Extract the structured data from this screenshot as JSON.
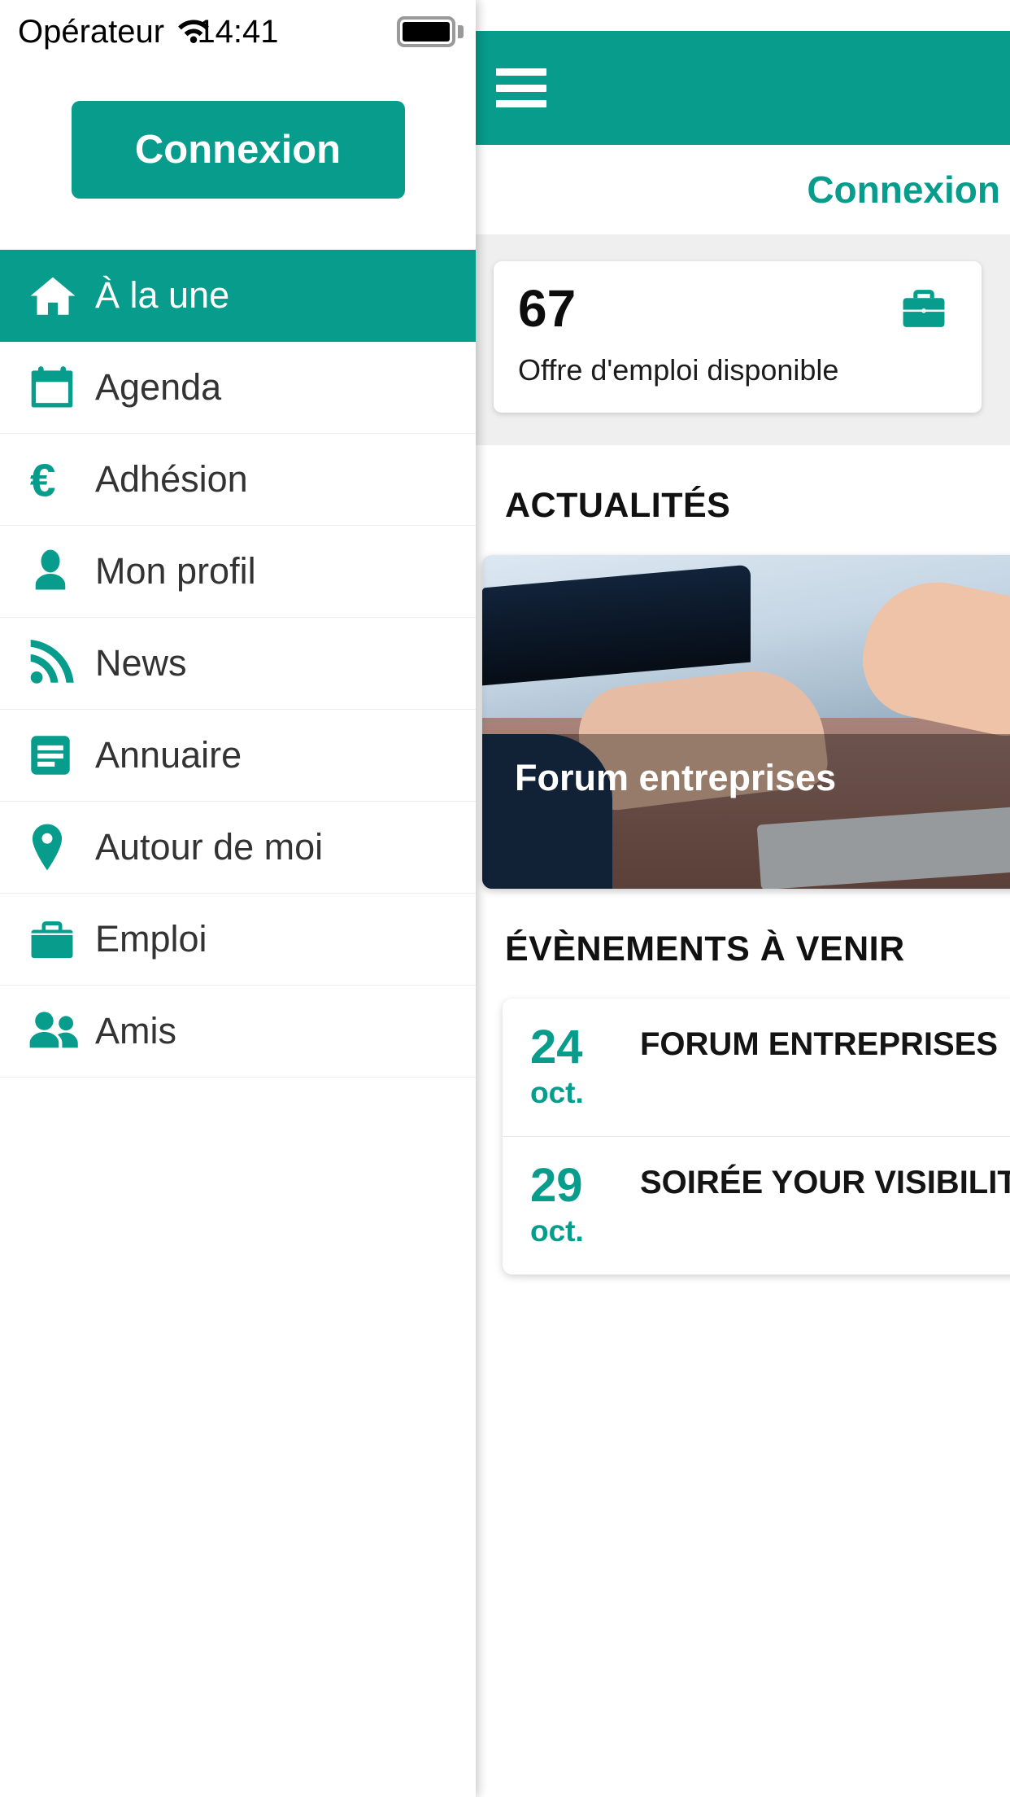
{
  "status_bar": {
    "carrier": "Opérateur",
    "time": "14:41",
    "wifi_icon": "wifi-icon",
    "battery_icon": "battery-full-icon"
  },
  "colors": {
    "accent": "#079c8b",
    "active_text": "#ffffff",
    "menu_text": "#333333",
    "page_bg": "#ffffff",
    "strip_bg": "#efefef"
  },
  "drawer": {
    "login_button": "Connexion",
    "items": [
      {
        "label": "À la une",
        "icon": "home-icon",
        "active": true
      },
      {
        "label": "Agenda",
        "icon": "calendar-icon",
        "active": false
      },
      {
        "label": "Adhésion",
        "icon": "euro-icon",
        "active": false
      },
      {
        "label": "Mon profil",
        "icon": "user-icon",
        "active": false
      },
      {
        "label": "News",
        "icon": "rss-icon",
        "active": false
      },
      {
        "label": "Annuaire",
        "icon": "list-icon",
        "active": false
      },
      {
        "label": "Autour de moi",
        "icon": "map-pin-icon",
        "active": false
      },
      {
        "label": "Emploi",
        "icon": "briefcase-icon",
        "active": false
      },
      {
        "label": "Amis",
        "icon": "people-icon",
        "active": false
      }
    ]
  },
  "main": {
    "menu_icon": "hamburger-menu-icon",
    "connexion_link": "Connexion",
    "stat_card": {
      "value": "67",
      "label": "Offre d'emploi disponible",
      "icon": "briefcase-icon"
    },
    "news_section": {
      "title": "ACTUALITÉS",
      "card_title": "Forum entreprises"
    },
    "events_section": {
      "title": "ÉVÈNEMENTS À VENIR",
      "events": [
        {
          "day": "24",
          "month": "oct.",
          "name": "FORUM ENTREPRISES"
        },
        {
          "day": "29",
          "month": "oct.",
          "name": "SOIRÉE YOUR VISIBILITÉ À LINKEDIN"
        }
      ]
    }
  }
}
